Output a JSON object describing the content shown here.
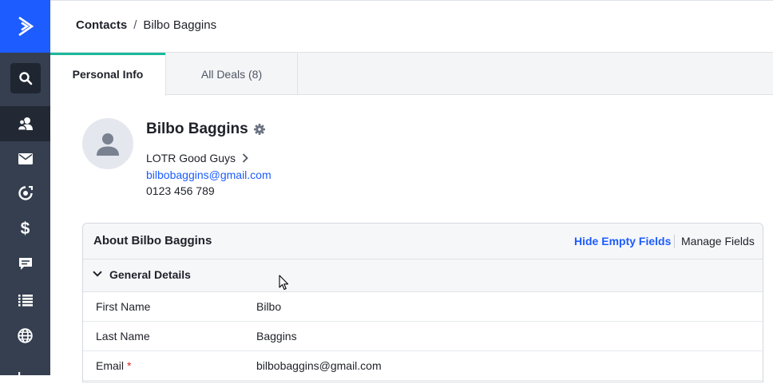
{
  "sidebar": {
    "logo_icon": "activecampaign-chevron-icon",
    "search_icon": "search-icon",
    "items": [
      {
        "name": "contacts",
        "icon": "contacts-icon",
        "active": true
      },
      {
        "name": "campaigns",
        "icon": "envelope-icon",
        "active": false
      },
      {
        "name": "automations",
        "icon": "automation-icon",
        "active": false
      },
      {
        "name": "deals",
        "icon": "dollar-icon",
        "glyph": "$",
        "active": false
      },
      {
        "name": "conversations",
        "icon": "chat-icon",
        "active": false
      },
      {
        "name": "lists",
        "icon": "list-icon",
        "active": false
      },
      {
        "name": "website",
        "icon": "globe-icon",
        "active": false
      },
      {
        "name": "reports",
        "icon": "bar-chart-icon",
        "active": false
      }
    ],
    "colors": {
      "background": "#353f50",
      "logo_bg": "#1d5cff",
      "active_bg": "#222935"
    }
  },
  "header": {
    "breadcrumb_root": "Contacts",
    "breadcrumb_separator": "/",
    "breadcrumb_current": "Bilbo Baggins"
  },
  "tabs": [
    {
      "label": "Personal Info",
      "active": true
    },
    {
      "label": "All Deals (8)",
      "active": false
    }
  ],
  "contact": {
    "name": "Bilbo Baggins",
    "account": "LOTR Good Guys",
    "email": "bilbobaggins@gmail.com",
    "phone": "0123 456 789"
  },
  "about": {
    "title": "About Bilbo Baggins",
    "hide_empty_label": "Hide Empty Fields",
    "manage_fields_label": "Manage Fields",
    "section_title": "General Details",
    "fields": [
      {
        "label": "First Name",
        "value": "Bilbo",
        "required": ""
      },
      {
        "label": "Last Name",
        "value": "Baggins",
        "required": ""
      },
      {
        "label": "Email",
        "value": "bilbobaggins@gmail.com",
        "required": "*"
      }
    ]
  },
  "colors": {
    "accent": "#1d5cff",
    "tab_indicator": "#1bb99a",
    "required": "#d22d2d"
  }
}
